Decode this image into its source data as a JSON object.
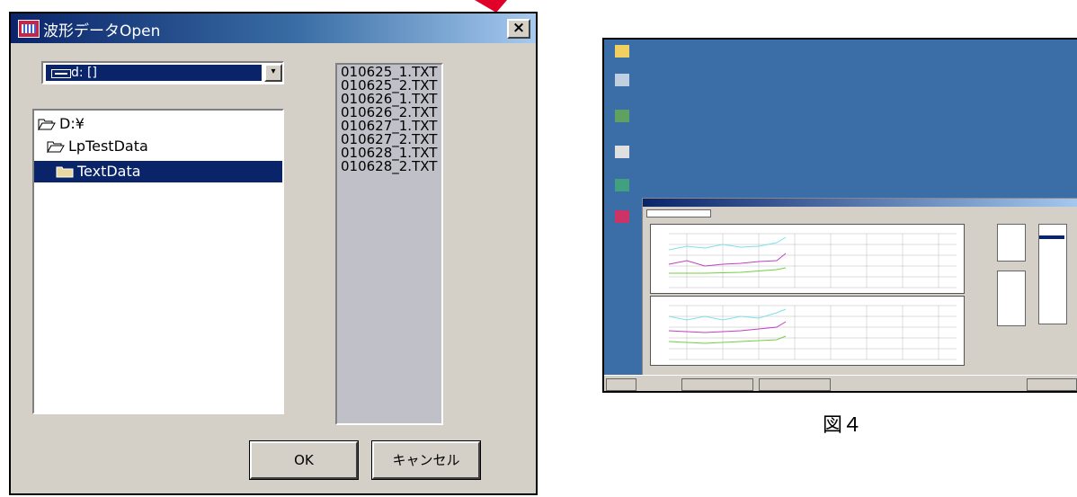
{
  "dialog": {
    "title": "波形データOpen",
    "close_label": "×",
    "drive_select": {
      "value": "d: []",
      "dropdown_label": "▾"
    },
    "folders": [
      {
        "label": "D:¥",
        "selected": false
      },
      {
        "label": "LpTestData",
        "selected": false
      },
      {
        "label": "TextData",
        "selected": true
      }
    ],
    "files": [
      "010625_1.TXT",
      "010625_2.TXT",
      "010626_1.TXT",
      "010626_2.TXT",
      "010627_1.TXT",
      "010627_2.TXT",
      "010628_1.TXT",
      "010628_2.TXT"
    ],
    "ok_label": "OK",
    "cancel_label": "キャンセル"
  },
  "figure_caption": "図４",
  "colors": {
    "title_start": "#0a246a",
    "title_end": "#a6caf0",
    "dialog_face": "#d4d0c8",
    "selection": "#0a246a",
    "desktop": "#3b6da6",
    "arrow": "#e0002a",
    "series_cyan": "#7fe0e8",
    "series_magenta": "#c040c0",
    "series_green": "#70d040"
  },
  "icons": [
    "app-icon",
    "close-icon",
    "drive-icon",
    "folder-open-icon",
    "folder-icon",
    "dropdown-arrow-icon"
  ]
}
